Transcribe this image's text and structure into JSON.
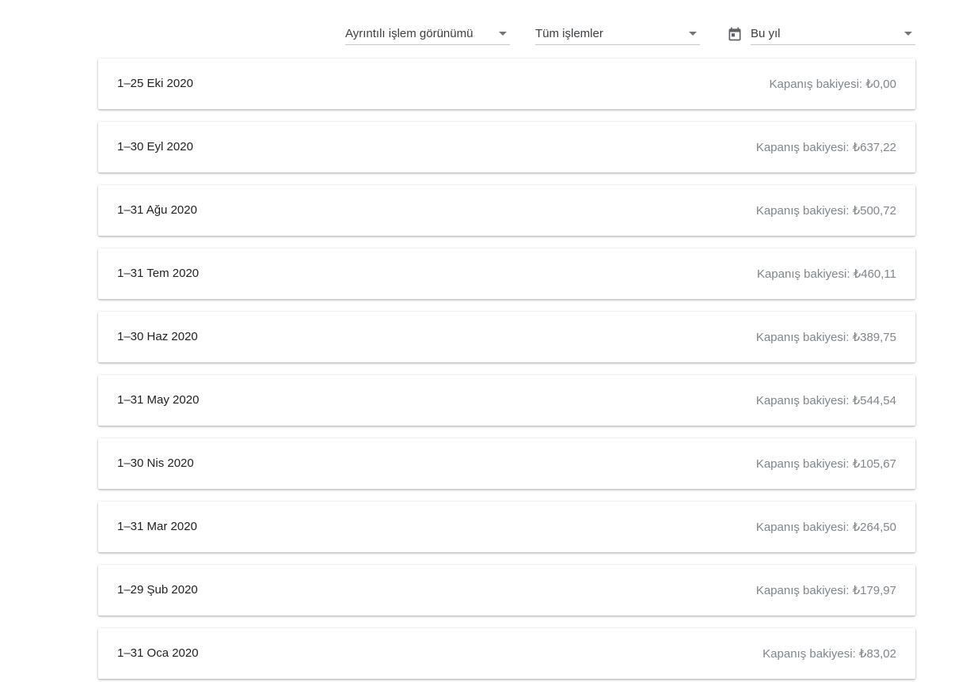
{
  "filters": {
    "view": {
      "label": "Ayrıntılı işlem görünümü"
    },
    "type": {
      "label": "Tüm işlemler"
    },
    "period": {
      "label": "Bu yıl"
    }
  },
  "balance_prefix": "Kapanış bakiyesi: ",
  "statements": [
    {
      "period": "1–25 Eki 2020",
      "balance": "₺0,00"
    },
    {
      "period": "1–30 Eyl 2020",
      "balance": "₺637,22"
    },
    {
      "period": "1–31 Ağu 2020",
      "balance": "₺500,72"
    },
    {
      "period": "1–31 Tem 2020",
      "balance": "₺460,11"
    },
    {
      "period": "1–30 Haz 2020",
      "balance": "₺389,75"
    },
    {
      "period": "1–31 May 2020",
      "balance": "₺544,54"
    },
    {
      "period": "1–30 Nis 2020",
      "balance": "₺105,67"
    },
    {
      "period": "1–31 Mar 2020",
      "balance": "₺264,50"
    },
    {
      "period": "1–29 Şub 2020",
      "balance": "₺179,97"
    },
    {
      "period": "1–31 Oca 2020",
      "balance": "₺83,02"
    }
  ],
  "icons": {
    "calendar": "calendar-icon",
    "dropdown": "arrow-drop-down-icon"
  }
}
